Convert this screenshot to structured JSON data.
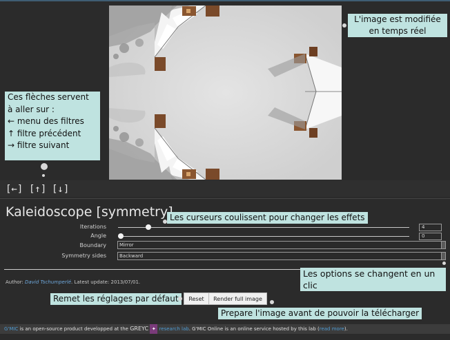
{
  "callouts": {
    "realtime": "L'image est modifiée en temps réel",
    "arrows_lines": [
      "Ces flèches servent",
      "à aller sur :",
      "← menu des filtres",
      "↑ filtre précédent",
      "→ filtre suivant"
    ],
    "sliders": "Les curseurs coulissent pour changer les effets",
    "options": "Les options se changent en un clic",
    "reset": "Remet les réglages par défaut",
    "render": "Prepare l'image avant de pouvoir la télécharger"
  },
  "nav": {
    "menu": "[←]",
    "prev": "[↑]",
    "next": "[↓]"
  },
  "filter": {
    "title": "Kaleidoscope [symmetry]",
    "params": [
      {
        "label": "Iterations",
        "value": "4",
        "level": 0.1
      },
      {
        "label": "Angle",
        "value": "0",
        "level": 0.0
      }
    ],
    "choices": [
      {
        "label": "Boundary",
        "value": "Mirror"
      },
      {
        "label": "Symmetry sides",
        "value": "Backward"
      }
    ]
  },
  "author": {
    "prefix": "Author:",
    "name": "David Tschumperlé",
    "suffix": ". Latest update: 2013/07/01."
  },
  "buttons": {
    "reset": "Reset",
    "render": "Render full image"
  },
  "footer": {
    "gmic": "G'MIC",
    "text1": " is an open-source product developped at the ",
    "greyc": "GREYC",
    "logo": "✦",
    "research_lab": "research lab",
    "text2": ". G'MIC Online is an online service hosted by this lab (",
    "read_more": "read more",
    "text3": ")."
  },
  "colors": {
    "background": "#2b2b2b",
    "callout": "#bfe3e0",
    "link": "#4f9bd2",
    "logo": "#7a3b7a"
  },
  "image": {
    "subject": "kaleidoscope snowy houses"
  }
}
